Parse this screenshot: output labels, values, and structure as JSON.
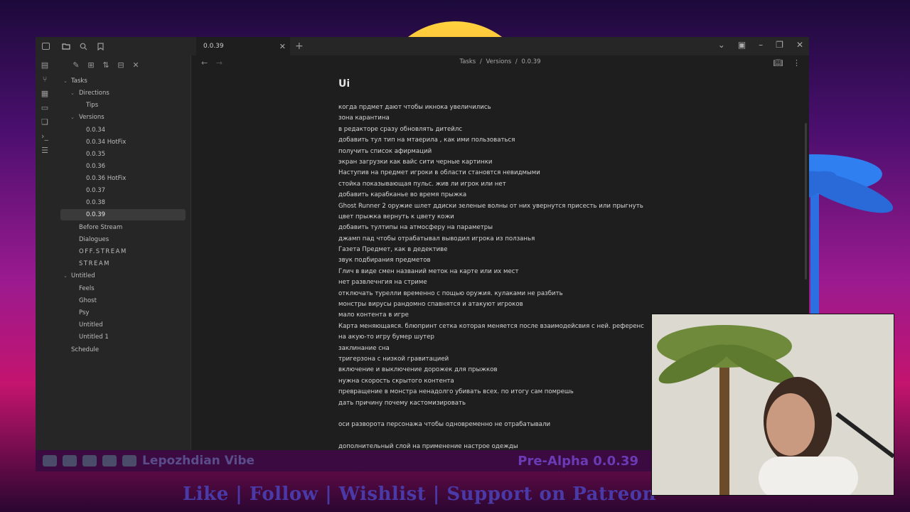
{
  "overlay": {
    "channel_name": "Lepozhdian Vibe",
    "version_tag": "Pre-Alpha 0.0.39",
    "footer_cta": "Like | Follow | Wishlist | Support on Patreon"
  },
  "app": {
    "tab": {
      "title": "0.0.39"
    },
    "breadcrumb": {
      "part1": "Tasks",
      "sep": "/",
      "part2": "Versions",
      "part3": "0.0.39"
    },
    "tree": {
      "tasks": "Tasks",
      "directions": "Directions",
      "tips": "Tips",
      "versions": "Versions",
      "v1": "0.0.34",
      "v2": "0.0.34 HotFix",
      "v3": "0.0.35",
      "v4": "0.0.36",
      "v5": "0.0.36 HotFix",
      "v6": "0.0.37",
      "v7": "0.0.38",
      "v8": "0.0.39",
      "before_stream": "Before Stream",
      "dialogues": "Dialogues",
      "off_stream": "OFF.STREAM",
      "stream": "STREAM",
      "untitled": "Untitled",
      "feels": "Feels",
      "ghost": "Ghost",
      "psy": "Psy",
      "untitled_child": "Untitled",
      "untitled_1": "Untitled 1",
      "schedule": "Schedule"
    },
    "document": {
      "title": "Ui",
      "lines": [
        "когда прдмет дают чтобы икнока увеличились",
        "зона карантина",
        "в редакторе сразу обновлять дитейлс",
        "добавить тул тип на мтаерила , как ими пользоваться",
        "получить список афирмаций",
        "экран загрузки как вайс сити черные картинки",
        "Наступив на предмет игроки в области становтся невидмыми",
        "стойка показывающая пульс. жив ли игрок или нет",
        "добавить карабканье во время прыжка",
        "Ghost Runner 2 оружие шлет ддиски зеленые волны от них увернутся присесть или прыгнуть",
        "цвет прыжка вернуть к цвету кожи",
        "добавить тултипы на атмосферу на параметры",
        "джамп пад чтобы отрабатывал выводил игрока из ползанья",
        "Газета Предмет, как в дедективе",
        "звук подбирания предметов",
        "Глич в виде смен названий меток на карте или их мест",
        "нет развлечнгия на стриме",
        "отключать турелли временно с пощью оружия. кулаками не разбить",
        "монстры вирусы рандомно спавнятся и атакуют игроков",
        "мало контента в игре",
        "Карта меняющаяся. блюпринт сетка которая меняется после взаимодейсвия с ней. референс",
        "на акую-то игру бумер шутер",
        "заклинание сна",
        "тригерзона с низкой гравитацией",
        "включение и выключение  дорожек для прыжков",
        "нужна скорость скрытого контента",
        "превращение в монстра ненадолго убивать всех. по итогу сам помрешь",
        "дать причину почему кастомизировать",
        "",
        "оси разворота персонажа чтобы одновременно не отрабатывали",
        "",
        "дополнительный слой на применение настрое одежды"
      ]
    }
  },
  "icons": [
    "sidebar-toggle-icon",
    "folder-icon",
    "search-icon",
    "bookmark-icon",
    "new-note-icon",
    "new-folder-icon",
    "sort-icon",
    "collapse-icon",
    "close-icon",
    "files-icon",
    "graph-icon",
    "canvas-icon",
    "calendar-icon",
    "copy-icon",
    "terminal-icon",
    "list-icon",
    "back-arrow-icon",
    "forward-arrow-icon",
    "reading-view-icon",
    "more-options-icon",
    "chevron-down-icon",
    "layout-icon",
    "minimize-icon",
    "restore-icon",
    "window-close-icon",
    "plus-icon"
  ]
}
